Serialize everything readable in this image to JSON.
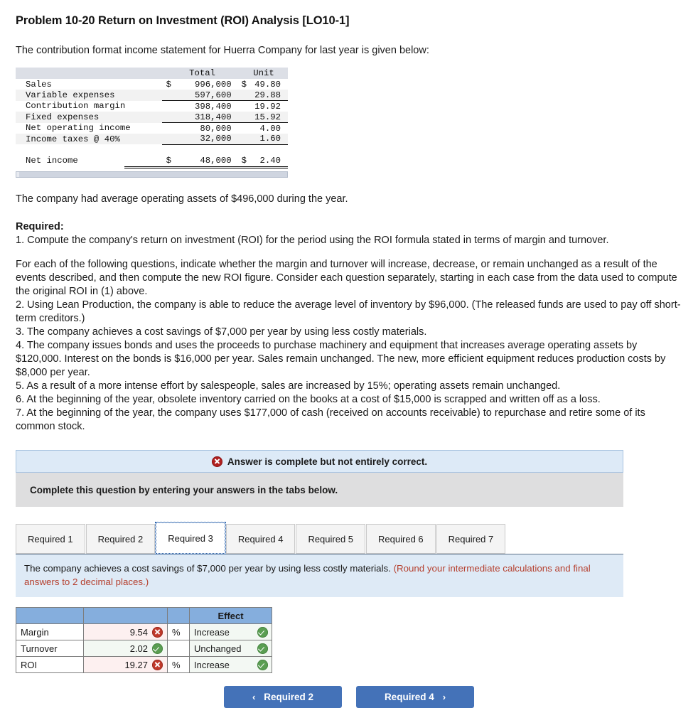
{
  "title": "Problem 10-20 Return on Investment (ROI) Analysis [LO10-1]",
  "intro": "The contribution format income statement for Huerra Company for last year is given below:",
  "income_statement": {
    "headers": [
      "",
      "Total",
      "Unit"
    ],
    "rows": [
      {
        "label": "Sales",
        "cur": "$",
        "total": "996,000",
        "cur2": "$",
        "unit": "49.80"
      },
      {
        "label": "Variable expenses",
        "cur": "",
        "total": "597,600",
        "cur2": "",
        "unit": "29.88"
      },
      {
        "label": "Contribution margin",
        "cur": "",
        "total": "398,400",
        "cur2": "",
        "unit": "19.92"
      },
      {
        "label": "Fixed expenses",
        "cur": "",
        "total": "318,400",
        "cur2": "",
        "unit": "15.92"
      },
      {
        "label": "Net operating income",
        "cur": "",
        "total": "80,000",
        "cur2": "",
        "unit": "4.00"
      },
      {
        "label": "Income taxes @ 40%",
        "cur": "",
        "total": "32,000",
        "cur2": "",
        "unit": "1.60"
      },
      {
        "label": "Net income",
        "cur": "$",
        "total": "48,000",
        "cur2": "$",
        "unit": "2.40"
      }
    ]
  },
  "assets_note": "The company had average operating assets of $496,000 during the year.",
  "required": {
    "heading": "Required:",
    "item1": "1. Compute the company's return on investment (ROI) for the period using the ROI formula stated in terms of margin and turnover.",
    "paragraph": "For each of the following questions, indicate whether the margin and turnover will increase, decrease, or remain unchanged as a result of the events described, and then compute the new ROI figure. Consider each question separately, starting in each case from the data used to compute the original ROI in (1) above.",
    "item2": "2. Using Lean Production, the company is able to reduce the average level of inventory by $96,000. (The released funds are used to pay off short-term creditors.)",
    "item3": "3. The company achieves a cost savings of $7,000 per year by using less costly materials.",
    "item4": "4. The company issues bonds and uses the proceeds to purchase machinery and equipment that increases average operating assets by $120,000. Interest on the bonds is $16,000 per year. Sales remain unchanged. The new, more efficient equipment reduces production costs by $8,000 per year.",
    "item5": "5. As a result of a more intense effort by salespeople, sales are increased by 15%; operating assets remain unchanged.",
    "item6": "6. At the beginning of the year, obsolete inventory carried on the books at a cost of $15,000 is scrapped and written off as a loss.",
    "item7": "7. At the beginning of the year, the company uses $177,000 of cash (received on accounts receivable) to repurchase and retire some of its common stock."
  },
  "status_banner": {
    "message": "Answer is complete but not entirely correct.",
    "icon": "error-x-icon"
  },
  "instruction_bar": "Complete this question by entering your answers in the tabs below.",
  "tabs": [
    {
      "label": "Required 1",
      "active": false
    },
    {
      "label": "Required 2",
      "active": false
    },
    {
      "label": "Required 3",
      "active": true
    },
    {
      "label": "Required 4",
      "active": false
    },
    {
      "label": "Required 5",
      "active": false
    },
    {
      "label": "Required 6",
      "active": false
    },
    {
      "label": "Required 7",
      "active": false
    }
  ],
  "panel": {
    "text": "The company achieves a cost savings of $7,000 per year by using less costly materials. ",
    "note": "(Round your intermediate calculations and final answers to 2 decimal places.)"
  },
  "answer_table": {
    "headers": [
      "",
      "",
      "",
      "Effect"
    ],
    "rows": [
      {
        "label": "Margin",
        "value": "9.54",
        "value_status": "incorrect",
        "unit": "%",
        "effect": "Increase",
        "effect_status": "correct"
      },
      {
        "label": "Turnover",
        "value": "2.02",
        "value_status": "correct",
        "unit": "",
        "effect": "Unchanged",
        "effect_status": "correct"
      },
      {
        "label": "ROI",
        "value": "19.27",
        "value_status": "incorrect",
        "unit": "%",
        "effect": "Increase",
        "effect_status": "correct"
      }
    ]
  },
  "nav": {
    "prev_label": "Required 2",
    "next_label": "Required 4",
    "prev_chevron": "‹",
    "next_chevron": "›"
  },
  "colors": {
    "accent_blue": "#4472b8",
    "header_blue": "#85aedd",
    "banner_blue": "#ddeaf7",
    "error_red": "#c0392b",
    "success_green": "#5a9e52",
    "note_red": "#b5402f"
  }
}
